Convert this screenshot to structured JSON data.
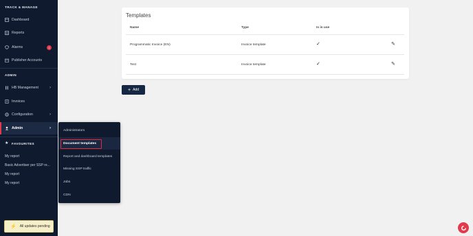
{
  "sidebar": {
    "section_track": "TRACK & MANAGE",
    "dashboard": "Dashboard",
    "reports": "Reports",
    "alarms": "Alarms",
    "alarms_badge": "1",
    "publisher_accounts": "Publisher Accounts",
    "section_admin": "ADMIN",
    "hb_management": "HB Management",
    "invoices": "Invoices",
    "configuration": "Configuration",
    "admin": "Admin",
    "section_favourites": "FAVOURITES",
    "favourites": [
      "My report",
      "Basic Advertiser per SSP re...",
      "My report",
      "My report"
    ],
    "pending_label": "All updates pending"
  },
  "flyout": {
    "items": [
      "Administrators",
      "Document templates",
      "Report and dashboard templates",
      "Missing SSP traffic",
      "Jobs",
      "CDN"
    ]
  },
  "card": {
    "title": "Templates",
    "columns": [
      "Name",
      "Type",
      "Is in use"
    ],
    "rows": [
      {
        "name": "Programmatic Invoice (EN)",
        "type": "Invoice template"
      },
      {
        "name": "Test",
        "type": "Invoice template"
      }
    ]
  },
  "add_label": "Add",
  "colors": {
    "sidebar_bg": "#0f1a2e",
    "accent": "#e03b4d",
    "button_bg": "#162744"
  }
}
